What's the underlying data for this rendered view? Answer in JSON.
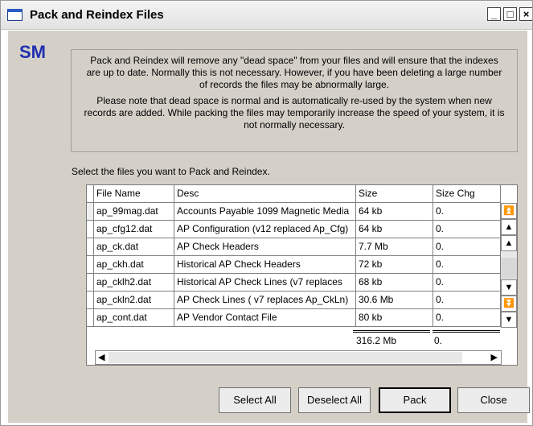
{
  "window": {
    "title": "Pack and Reindex Files",
    "min_glyph": "_",
    "max_glyph": "□",
    "close_glyph": "×"
  },
  "logo": "SM",
  "info": {
    "para1": "Pack and Reindex will remove any \"dead space\" from your files and will ensure that the indexes are up to date.  Normally this is not necessary.  However, if you have been deleting a large number of records the files may be abnormally large.",
    "para2": "Please note that dead space is normal and is automatically re-used by the system when new records are added.  While packing the files may temporarily increase the speed of your system, it is not normally necessary."
  },
  "select_label": "Select the files you want to Pack and Reindex.",
  "grid": {
    "headers": [
      "File Name",
      "Desc",
      "Size",
      "Size Chg"
    ],
    "rows": [
      {
        "file": "ap_99mag.dat",
        "desc": "Accounts Payable 1099 Magnetic Media",
        "size": "64 kb",
        "chg": "0."
      },
      {
        "file": "ap_cfg12.dat",
        "desc": "AP Configuration (v12 replaced Ap_Cfg)",
        "size": "64 kb",
        "chg": "0."
      },
      {
        "file": "ap_ck.dat",
        "desc": "AP Check Headers",
        "size": "7.7 Mb",
        "chg": "0."
      },
      {
        "file": "ap_ckh.dat",
        "desc": "Historical AP Check Headers",
        "size": "72 kb",
        "chg": "0."
      },
      {
        "file": "ap_cklh2.dat",
        "desc": "Historical AP Check Lines (v7 replaces",
        "size": "68 kb",
        "chg": "0."
      },
      {
        "file": "ap_ckln2.dat",
        "desc": "AP Check Lines ( v7 replaces Ap_CkLn)",
        "size": "30.6 Mb",
        "chg": "0."
      },
      {
        "file": "ap_cont.dat",
        "desc": "AP Vendor Contact File",
        "size": "80 kb",
        "chg": "0."
      }
    ],
    "total_size": "316.2 Mb",
    "total_chg": "0."
  },
  "buttons": {
    "select_all": "Select All",
    "deselect_all": "Deselect All",
    "pack": "Pack",
    "close": "Close"
  }
}
